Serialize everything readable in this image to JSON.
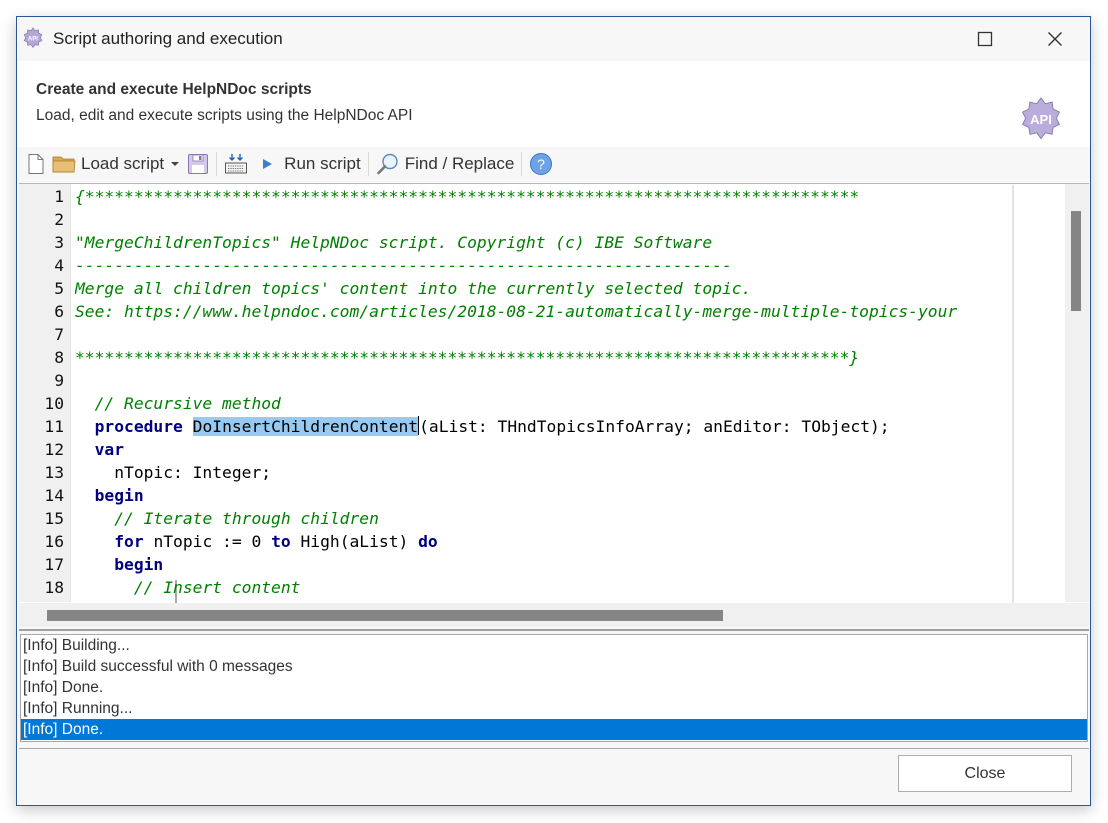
{
  "window": {
    "title": "Script authoring and execution",
    "app_icon": "api-gear-icon",
    "controls": {
      "maximize_icon": "maximize-icon",
      "close_icon": "close-icon"
    }
  },
  "header": {
    "title": "Create and execute HelpNDoc scripts",
    "subtitle": "Load, edit and execute scripts using the HelpNDoc API",
    "logo_text": "API"
  },
  "toolbar": {
    "new_icon": "new-document-icon",
    "load_label": "Load script",
    "load_icon": "folder-icon",
    "save_icon": "save-disk-icon",
    "build_icon": "build-keyboard-icon",
    "run_label": "Run script",
    "run_icon": "play-icon",
    "find_label": "Find / Replace",
    "find_icon": "magnifier-icon",
    "help_icon": "help-icon",
    "help_glyph": "?"
  },
  "editor": {
    "lines": [
      {
        "n": "1",
        "segments": [
          {
            "t": "{*******************************************************************************",
            "c": "cm"
          }
        ]
      },
      {
        "n": "2",
        "segments": []
      },
      {
        "n": "3",
        "segments": [
          {
            "t": "\"MergeChildrenTopics\" HelpNDoc script. Copyright (c) IBE Software",
            "c": "cm"
          }
        ]
      },
      {
        "n": "4",
        "segments": [
          {
            "t": "-------------------------------------------------------------------",
            "c": "cm"
          }
        ]
      },
      {
        "n": "5",
        "segments": [
          {
            "t": "Merge all children topics' content into the currently selected topic.",
            "c": "cm"
          }
        ]
      },
      {
        "n": "6",
        "segments": [
          {
            "t": "See: https://www.helpndoc.com/articles/2018-08-21-automatically-merge-multiple-topics-your",
            "c": "cm"
          }
        ]
      },
      {
        "n": "7",
        "segments": []
      },
      {
        "n": "8",
        "segments": [
          {
            "t": "*******************************************************************************}",
            "c": "cm"
          }
        ]
      },
      {
        "n": "9",
        "segments": []
      },
      {
        "n": "10",
        "segments": [
          {
            "t": "  ",
            "c": "tx"
          },
          {
            "t": "// Recursive method",
            "c": "cm"
          }
        ]
      },
      {
        "n": "11",
        "segments": [
          {
            "t": "  ",
            "c": "tx"
          },
          {
            "t": "procedure",
            "c": "kw"
          },
          {
            "t": " ",
            "c": "tx"
          },
          {
            "t": "DoInsertChildrenContent",
            "c": "tx sel"
          },
          {
            "t": "|caret|",
            "c": "caret"
          },
          {
            "t": "(aList: THndTopicsInfoArray; anEditor: TObject);",
            "c": "tx"
          }
        ]
      },
      {
        "n": "12",
        "segments": [
          {
            "t": "  ",
            "c": "tx"
          },
          {
            "t": "var",
            "c": "kw"
          }
        ]
      },
      {
        "n": "13",
        "segments": [
          {
            "t": "    nTopic: Integer;",
            "c": "tx"
          }
        ]
      },
      {
        "n": "14",
        "segments": [
          {
            "t": "  ",
            "c": "tx"
          },
          {
            "t": "begin",
            "c": "kw"
          }
        ]
      },
      {
        "n": "15",
        "segments": [
          {
            "t": "    ",
            "c": "tx"
          },
          {
            "t": "// Iterate through children",
            "c": "cm"
          }
        ]
      },
      {
        "n": "16",
        "segments": [
          {
            "t": "    ",
            "c": "tx"
          },
          {
            "t": "for",
            "c": "kw"
          },
          {
            "t": " nTopic := 0 ",
            "c": "tx"
          },
          {
            "t": "to",
            "c": "kw"
          },
          {
            "t": " High(aList) ",
            "c": "tx"
          },
          {
            "t": "do",
            "c": "kw"
          }
        ]
      },
      {
        "n": "17",
        "segments": [
          {
            "t": "    ",
            "c": "tx"
          },
          {
            "t": "begin",
            "c": "kw"
          }
        ]
      },
      {
        "n": "18",
        "segments": [
          {
            "t": "      ",
            "c": "tx"
          },
          {
            "t": "// Insert content",
            "c": "cm"
          }
        ]
      }
    ],
    "vertical_scroll_position": 0.05,
    "horizontal_scroll_position": 0.0
  },
  "log": {
    "items": [
      {
        "text": "[Info] Building...",
        "selected": false
      },
      {
        "text": "[Info] Build successful with 0 messages",
        "selected": false
      },
      {
        "text": "[Info] Done.",
        "selected": false
      },
      {
        "text": "[Info] Running...",
        "selected": false
      },
      {
        "text": "[Info] Done.",
        "selected": true
      }
    ]
  },
  "footer": {
    "close_label": "Close"
  },
  "colors": {
    "comment": "#008000",
    "keyword": "#000080",
    "selection": "#99c9ef",
    "log_selection": "#0078d7",
    "window_border": "#2b5797",
    "api_logo": "#b4a7d6"
  }
}
